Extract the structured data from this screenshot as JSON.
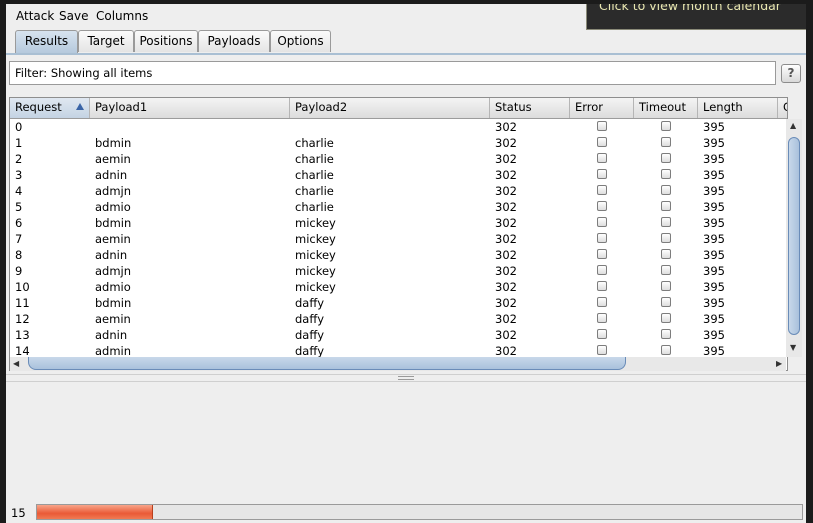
{
  "menu": [
    "Attack",
    "Save",
    "Columns"
  ],
  "tooltip": "Click to view month calendar",
  "tabs": [
    "Results",
    "Target",
    "Positions",
    "Payloads",
    "Options"
  ],
  "active_tab": "Results",
  "filter": {
    "label": "Filter:",
    "text": "Showing all items"
  },
  "help_label": "?",
  "table": {
    "columns": [
      "Request",
      "Payload1",
      "Payload2",
      "Status",
      "Error",
      "Timeout",
      "Length",
      "C"
    ],
    "rows": [
      {
        "request": "0",
        "payload1": "",
        "payload2": "",
        "status": "302",
        "length": "395"
      },
      {
        "request": "1",
        "payload1": "bdmin",
        "payload2": "charlie",
        "status": "302",
        "length": "395"
      },
      {
        "request": "2",
        "payload1": "aemin",
        "payload2": "charlie",
        "status": "302",
        "length": "395"
      },
      {
        "request": "3",
        "payload1": "adnin",
        "payload2": "charlie",
        "status": "302",
        "length": "395"
      },
      {
        "request": "4",
        "payload1": "admjn",
        "payload2": "charlie",
        "status": "302",
        "length": "395"
      },
      {
        "request": "5",
        "payload1": "admio",
        "payload2": "charlie",
        "status": "302",
        "length": "395"
      },
      {
        "request": "6",
        "payload1": "bdmin",
        "payload2": "mickey",
        "status": "302",
        "length": "395"
      },
      {
        "request": "7",
        "payload1": "aemin",
        "payload2": "mickey",
        "status": "302",
        "length": "395"
      },
      {
        "request": "8",
        "payload1": "adnin",
        "payload2": "mickey",
        "status": "302",
        "length": "395"
      },
      {
        "request": "9",
        "payload1": "admjn",
        "payload2": "mickey",
        "status": "302",
        "length": "395"
      },
      {
        "request": "10",
        "payload1": "admio",
        "payload2": "mickey",
        "status": "302",
        "length": "395"
      },
      {
        "request": "11",
        "payload1": "bdmin",
        "payload2": "daffy",
        "status": "302",
        "length": "395"
      },
      {
        "request": "12",
        "payload1": "aemin",
        "payload2": "daffy",
        "status": "302",
        "length": "395"
      },
      {
        "request": "13",
        "payload1": "adnin",
        "payload2": "daffy",
        "status": "302",
        "length": "395"
      },
      {
        "request": "14",
        "payload1": "admin",
        "payload2": "daffy",
        "status": "302",
        "length": "395"
      }
    ]
  },
  "status": {
    "count": "15",
    "progress_fraction": 0.15
  }
}
